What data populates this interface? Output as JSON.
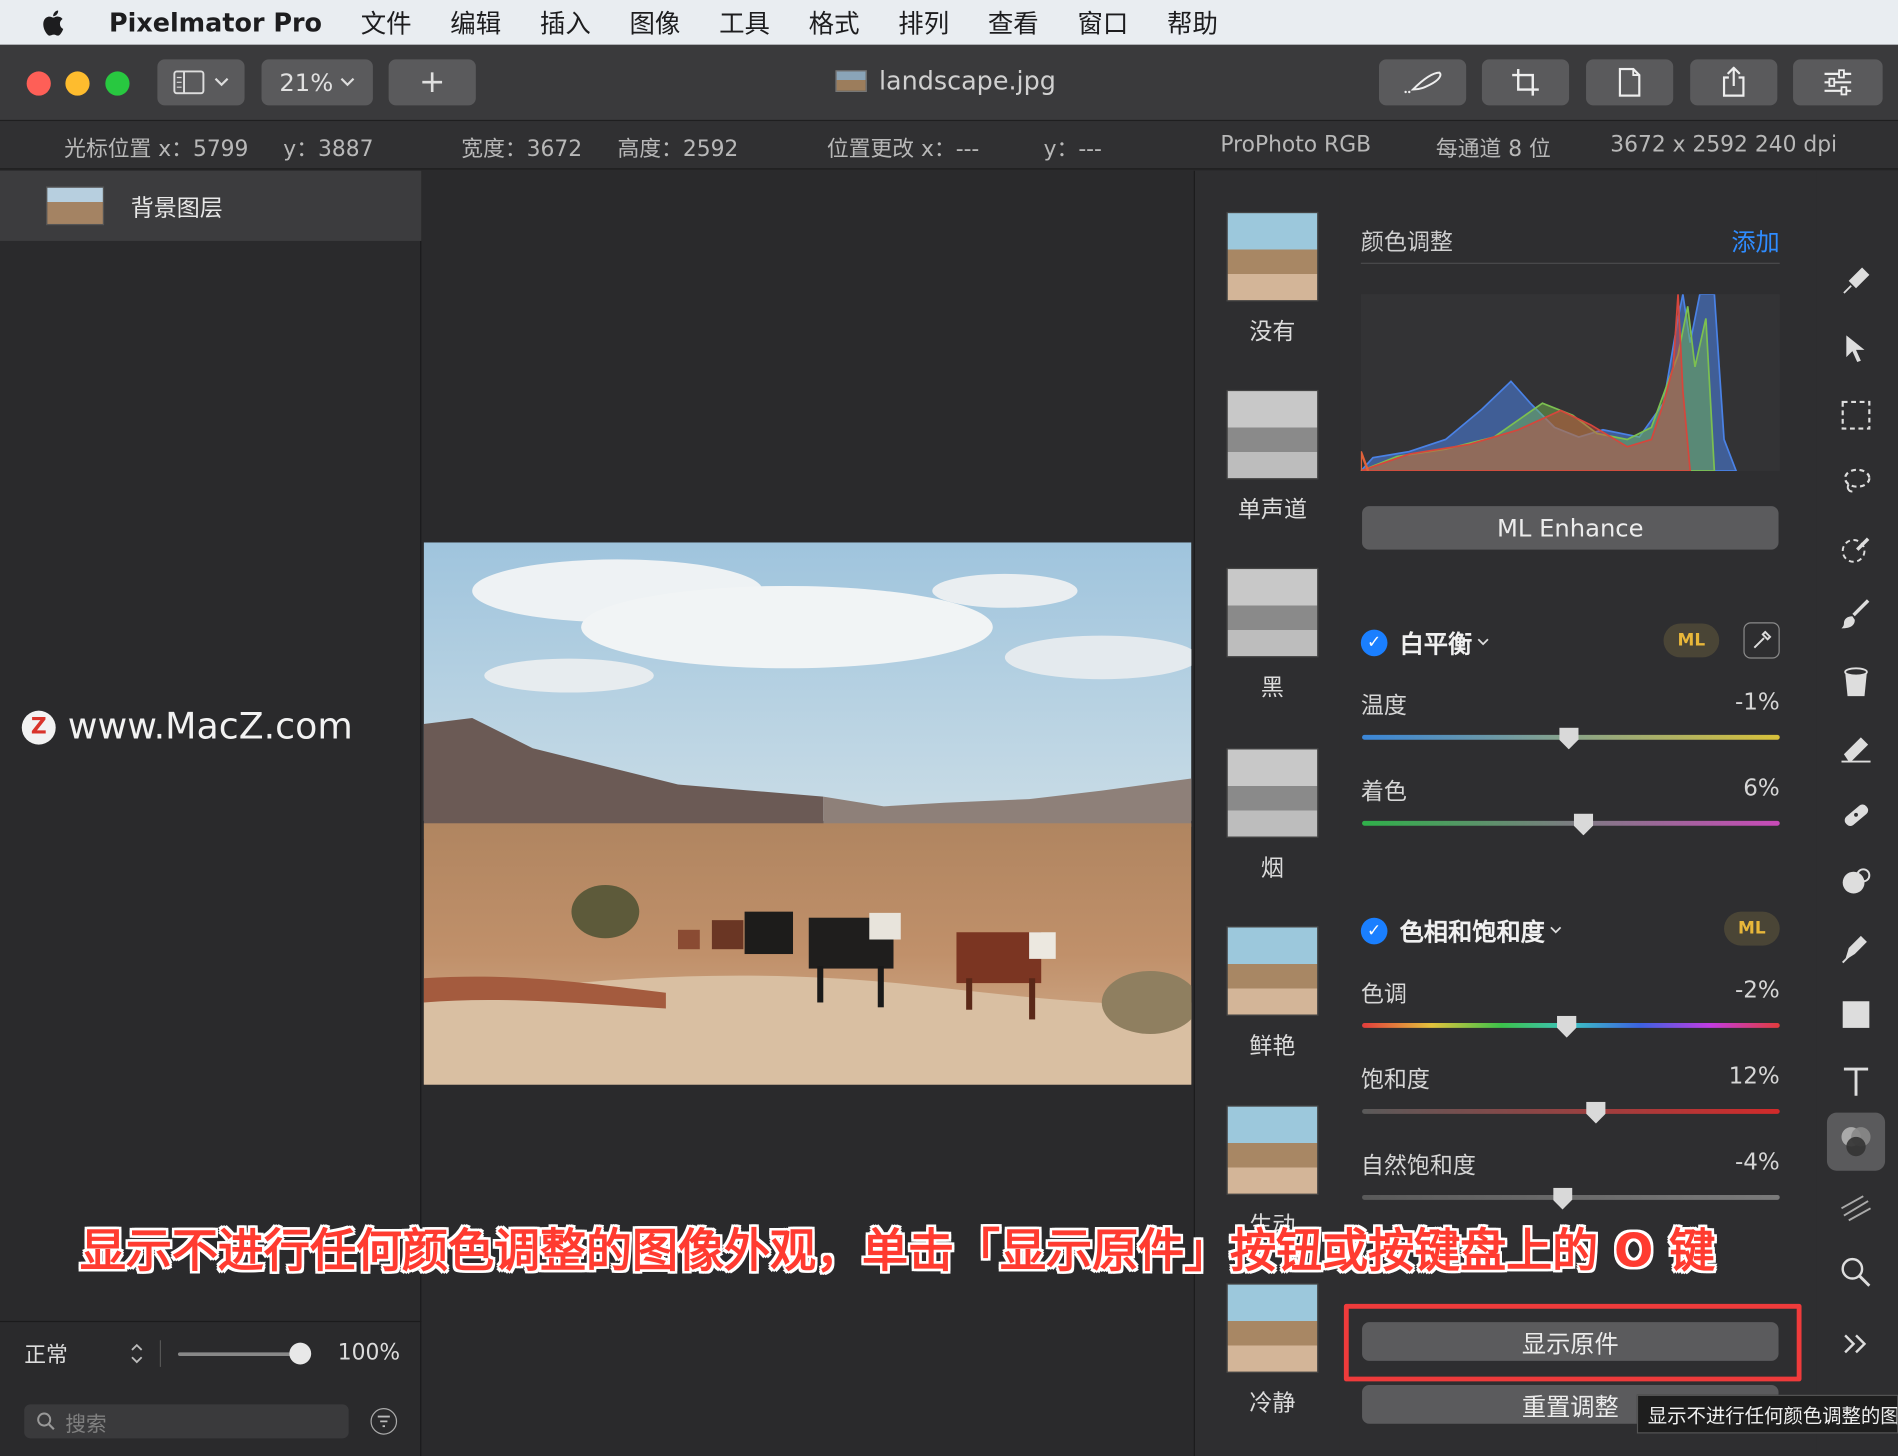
{
  "menubar": {
    "app_name": "Pixelmator Pro",
    "items": [
      "文件",
      "编辑",
      "插入",
      "图像",
      "工具",
      "格式",
      "排列",
      "查看",
      "窗口",
      "帮助"
    ]
  },
  "toolbar": {
    "zoom_label": "21%",
    "add_label": "+",
    "doc_title": "landscape.jpg"
  },
  "infobar": {
    "cursor_x": "光标位置 x：5799",
    "cursor_y": "y：3887",
    "width": "宽度：3672",
    "height": "高度：2592",
    "offset_x": "位置更改 x：---",
    "offset_y": "y：---",
    "color_profile": "ProPhoto RGB",
    "bit_depth": "每通道 8 位",
    "dimensions": "3672 x 2592 240 dpi"
  },
  "layers": {
    "items": [
      {
        "name": "背景图层"
      }
    ],
    "blend_mode": "正常",
    "opacity": "100%",
    "opacity_fraction": 1.0,
    "search_placeholder": "搜索"
  },
  "watermark": {
    "text": "www.MacZ.com",
    "logo_letter": "Z"
  },
  "presets": {
    "items": [
      {
        "label": "没有",
        "style": "color"
      },
      {
        "label": "单声道",
        "style": "mono"
      },
      {
        "label": "黑",
        "style": "mono"
      },
      {
        "label": "烟",
        "style": "mono"
      },
      {
        "label": "鲜艳",
        "style": "color"
      },
      {
        "label": "生动",
        "style": "color"
      },
      {
        "label": "冷静",
        "style": "color"
      }
    ]
  },
  "adjustments": {
    "title": "颜色调整",
    "add_label": "添加",
    "ml_enhance_label": "ML Enhance",
    "white_balance": {
      "title": "白平衡",
      "ml_label": "ML",
      "temperature": {
        "label": "温度",
        "value": "-1%",
        "level": -0.01
      },
      "tint": {
        "label": "着色",
        "value": "6%",
        "level": 0.06
      }
    },
    "hue_saturation": {
      "title": "色相和饱和度",
      "ml_label": "ML",
      "hue": {
        "label": "色调",
        "value": "-2%",
        "level": -0.02
      },
      "saturation": {
        "label": "饱和度",
        "value": "12%",
        "level": 0.12
      },
      "vibrance": {
        "label": "自然饱和度",
        "value": "-4%",
        "level": -0.04
      }
    },
    "show_original_label": "显示原件",
    "reset_label": "重置调整"
  },
  "tools": [
    "paint-style-icon",
    "arrange-pointer-icon",
    "rect-select-icon",
    "lasso-select-icon",
    "color-select-icon",
    "brush-icon",
    "fill-bucket-icon",
    "eraser-icon",
    "repair-icon",
    "retouch-icon",
    "pen-icon",
    "shape-icon",
    "text-icon",
    "color-adjust-icon",
    "effects-icon",
    "zoom-icon",
    "more-tools-icon"
  ],
  "overlay": {
    "caption": "显示不进行任何颜色调整的图像外观，单击「显示原件」按钮或按键盘上的 O 键",
    "tooltip": "显示不进行任何颜色调整的图像外观"
  },
  "colors": {
    "accent_blue": "#1a7fff",
    "link_blue": "#2f8cff",
    "ml_gold": "#e8b73a",
    "highlight_red": "#ef3b3b",
    "caption_red": "#ff3b30"
  }
}
